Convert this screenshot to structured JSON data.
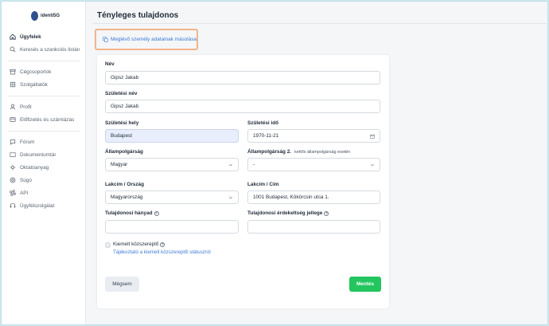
{
  "app": {
    "logo_text": "identi5G"
  },
  "sidebar": {
    "items": [
      {
        "label": "Ügyfelek",
        "icon": "home-icon"
      },
      {
        "label": "Keresés a szankciós listán",
        "icon": "search-icon"
      },
      {
        "label": "Cégcsoportok",
        "icon": "archive-icon"
      },
      {
        "label": "Szolgáltatók",
        "icon": "building-icon"
      },
      {
        "label": "Profil",
        "icon": "user-icon"
      },
      {
        "label": "Előfizetés és számlázás",
        "icon": "credit-card-icon"
      },
      {
        "label": "Fórum",
        "icon": "chat-icon"
      },
      {
        "label": "Dokumentumtár",
        "icon": "book-icon"
      },
      {
        "label": "Oktatóanyag",
        "icon": "lightbulb-icon"
      },
      {
        "label": "Súgó",
        "icon": "help-icon"
      },
      {
        "label": "API",
        "icon": "command-icon"
      },
      {
        "label": "Ügyfélszolgálat",
        "icon": "headset-icon"
      }
    ]
  },
  "page": {
    "title": "Tényleges tulajdonos",
    "copy_action": "Meglévő személy adatainak másolása"
  },
  "form": {
    "name_label": "Név",
    "name_value": "Gipsz Jakab",
    "birth_name_label": "Születési név",
    "birth_name_value": "Gipsz Jakab",
    "birth_place_label": "Születési hely",
    "birth_place_value": "Budapest",
    "birth_date_label": "Születési idő",
    "birth_date_value": "1970-11-21",
    "citizenship_label": "Állampolgárság",
    "citizenship_value": "Magyar",
    "citizenship2_label": "Állampolgárság 2.",
    "citizenship2_sub": "kettős állampolgárság esetén",
    "citizenship2_value": "-",
    "residence_country_label": "Lakcím / Ország",
    "residence_country_value": "Magyarország",
    "address_label": "Lakcím / Cím",
    "address_value": "1001 Budapest, Kökörcsin utca 1.",
    "ownership_share_label": "Tulajdonosi hányad",
    "ownership_share_value": "",
    "ownership_nature_label": "Tulajdonosi érdekeltség jellege",
    "ownership_nature_value": "",
    "pep_label": "Kiemelt közszereplő",
    "pep_link": "Tájékoztató a kiemelt közszereplői státuszról"
  },
  "buttons": {
    "cancel": "Mégsem",
    "save": "Mentés"
  },
  "colors": {
    "accent": "#3d7ad6",
    "save": "#22c55e",
    "highlight_border": "#f2b48a"
  }
}
